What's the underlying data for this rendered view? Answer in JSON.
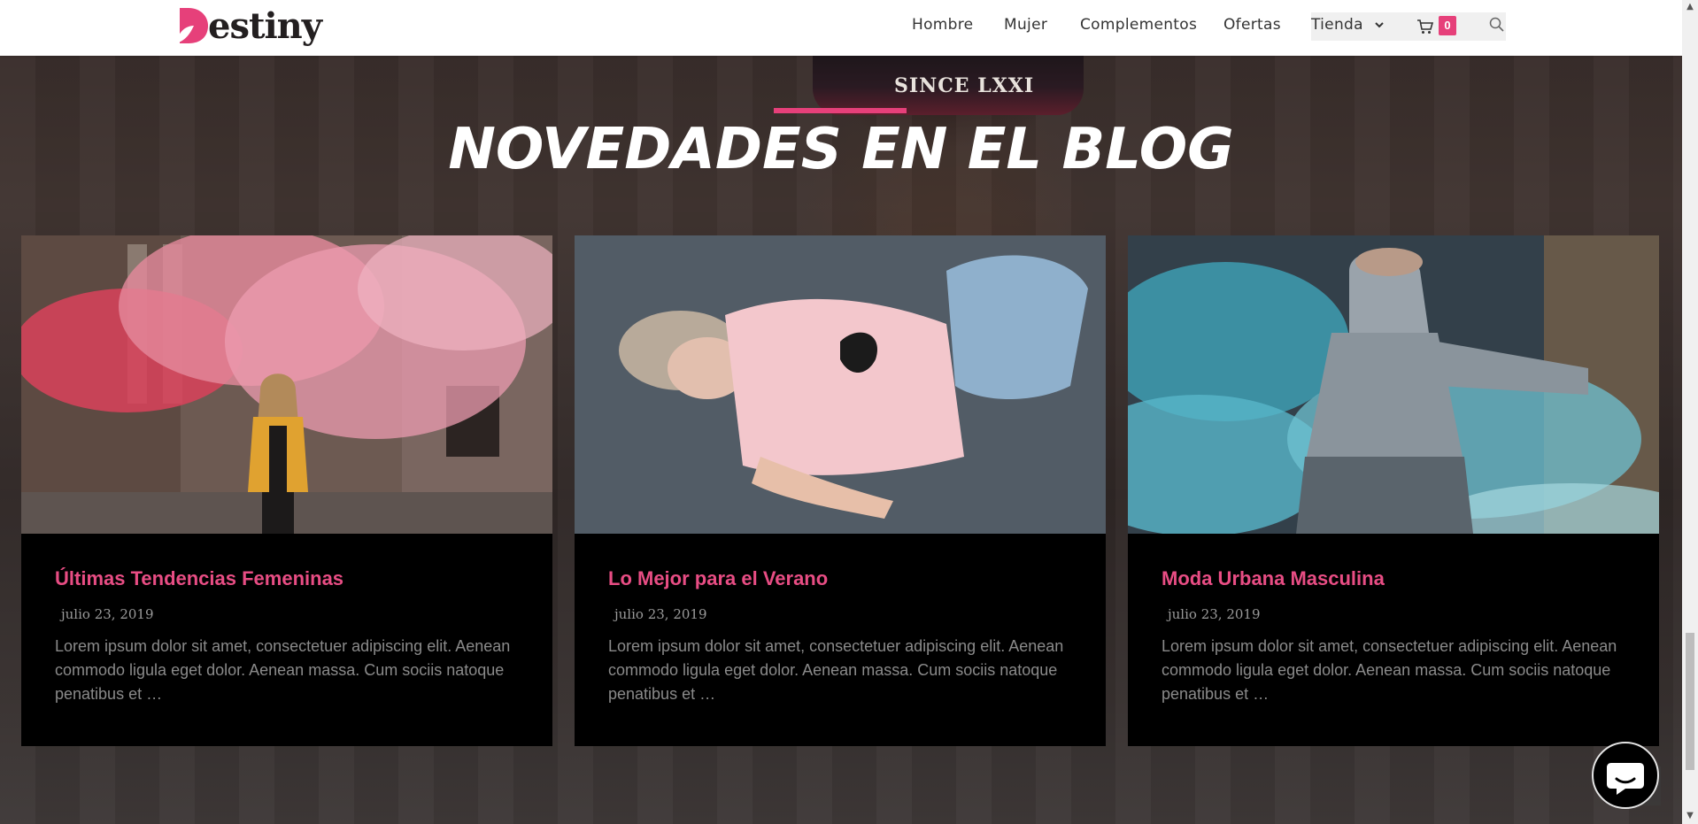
{
  "brand": {
    "name": "estiny",
    "accent": "#e6407a"
  },
  "nav": {
    "items": [
      "Hombre",
      "Mujer",
      "Complementos",
      "Ofertas"
    ],
    "shop_label": "Tienda",
    "cart_count": "0"
  },
  "background": {
    "cap_text": "SINCE LXXI"
  },
  "section": {
    "title": "NOVEDADES EN EL BLOG"
  },
  "posts": [
    {
      "title": "Últimas Tendencias Femeninas",
      "date": "julio 23, 2019",
      "excerpt": "Lorem ipsum dolor sit amet, consectetuer adipiscing elit. Aenean commodo ligula eget dolor. Aenean massa. Cum sociis natoque penatibus et …"
    },
    {
      "title": "Lo Mejor para el Verano",
      "date": "julio 23, 2019",
      "excerpt": "Lorem ipsum dolor sit amet, consectetuer adipiscing elit. Aenean commodo ligula eget dolor. Aenean massa. Cum sociis natoque penatibus et …"
    },
    {
      "title": "Moda Urbana Masculina",
      "date": "julio 23, 2019",
      "excerpt": "Lorem ipsum dolor sit amet, consectetuer adipiscing elit. Aenean commodo ligula eget dolor. Aenean massa. Cum sociis natoque penatibus et …"
    }
  ]
}
